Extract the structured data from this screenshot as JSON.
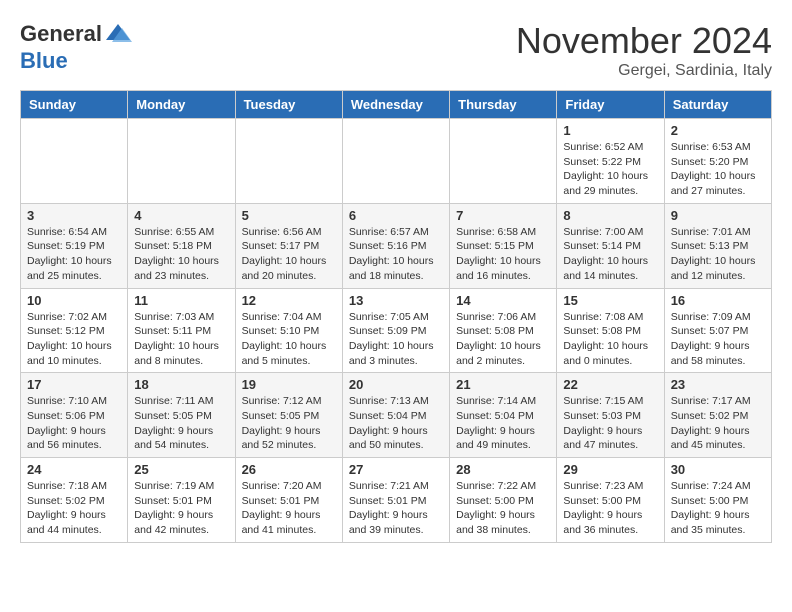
{
  "header": {
    "logo_general": "General",
    "logo_blue": "Blue",
    "month_title": "November 2024",
    "location": "Gergei, Sardinia, Italy"
  },
  "days_of_week": [
    "Sunday",
    "Monday",
    "Tuesday",
    "Wednesday",
    "Thursday",
    "Friday",
    "Saturday"
  ],
  "weeks": [
    [
      {
        "day": "",
        "info": ""
      },
      {
        "day": "",
        "info": ""
      },
      {
        "day": "",
        "info": ""
      },
      {
        "day": "",
        "info": ""
      },
      {
        "day": "",
        "info": ""
      },
      {
        "day": "1",
        "info": "Sunrise: 6:52 AM\nSunset: 5:22 PM\nDaylight: 10 hours and 29 minutes."
      },
      {
        "day": "2",
        "info": "Sunrise: 6:53 AM\nSunset: 5:20 PM\nDaylight: 10 hours and 27 minutes."
      }
    ],
    [
      {
        "day": "3",
        "info": "Sunrise: 6:54 AM\nSunset: 5:19 PM\nDaylight: 10 hours and 25 minutes."
      },
      {
        "day": "4",
        "info": "Sunrise: 6:55 AM\nSunset: 5:18 PM\nDaylight: 10 hours and 23 minutes."
      },
      {
        "day": "5",
        "info": "Sunrise: 6:56 AM\nSunset: 5:17 PM\nDaylight: 10 hours and 20 minutes."
      },
      {
        "day": "6",
        "info": "Sunrise: 6:57 AM\nSunset: 5:16 PM\nDaylight: 10 hours and 18 minutes."
      },
      {
        "day": "7",
        "info": "Sunrise: 6:58 AM\nSunset: 5:15 PM\nDaylight: 10 hours and 16 minutes."
      },
      {
        "day": "8",
        "info": "Sunrise: 7:00 AM\nSunset: 5:14 PM\nDaylight: 10 hours and 14 minutes."
      },
      {
        "day": "9",
        "info": "Sunrise: 7:01 AM\nSunset: 5:13 PM\nDaylight: 10 hours and 12 minutes."
      }
    ],
    [
      {
        "day": "10",
        "info": "Sunrise: 7:02 AM\nSunset: 5:12 PM\nDaylight: 10 hours and 10 minutes."
      },
      {
        "day": "11",
        "info": "Sunrise: 7:03 AM\nSunset: 5:11 PM\nDaylight: 10 hours and 8 minutes."
      },
      {
        "day": "12",
        "info": "Sunrise: 7:04 AM\nSunset: 5:10 PM\nDaylight: 10 hours and 5 minutes."
      },
      {
        "day": "13",
        "info": "Sunrise: 7:05 AM\nSunset: 5:09 PM\nDaylight: 10 hours and 3 minutes."
      },
      {
        "day": "14",
        "info": "Sunrise: 7:06 AM\nSunset: 5:08 PM\nDaylight: 10 hours and 2 minutes."
      },
      {
        "day": "15",
        "info": "Sunrise: 7:08 AM\nSunset: 5:08 PM\nDaylight: 10 hours and 0 minutes."
      },
      {
        "day": "16",
        "info": "Sunrise: 7:09 AM\nSunset: 5:07 PM\nDaylight: 9 hours and 58 minutes."
      }
    ],
    [
      {
        "day": "17",
        "info": "Sunrise: 7:10 AM\nSunset: 5:06 PM\nDaylight: 9 hours and 56 minutes."
      },
      {
        "day": "18",
        "info": "Sunrise: 7:11 AM\nSunset: 5:05 PM\nDaylight: 9 hours and 54 minutes."
      },
      {
        "day": "19",
        "info": "Sunrise: 7:12 AM\nSunset: 5:05 PM\nDaylight: 9 hours and 52 minutes."
      },
      {
        "day": "20",
        "info": "Sunrise: 7:13 AM\nSunset: 5:04 PM\nDaylight: 9 hours and 50 minutes."
      },
      {
        "day": "21",
        "info": "Sunrise: 7:14 AM\nSunset: 5:04 PM\nDaylight: 9 hours and 49 minutes."
      },
      {
        "day": "22",
        "info": "Sunrise: 7:15 AM\nSunset: 5:03 PM\nDaylight: 9 hours and 47 minutes."
      },
      {
        "day": "23",
        "info": "Sunrise: 7:17 AM\nSunset: 5:02 PM\nDaylight: 9 hours and 45 minutes."
      }
    ],
    [
      {
        "day": "24",
        "info": "Sunrise: 7:18 AM\nSunset: 5:02 PM\nDaylight: 9 hours and 44 minutes."
      },
      {
        "day": "25",
        "info": "Sunrise: 7:19 AM\nSunset: 5:01 PM\nDaylight: 9 hours and 42 minutes."
      },
      {
        "day": "26",
        "info": "Sunrise: 7:20 AM\nSunset: 5:01 PM\nDaylight: 9 hours and 41 minutes."
      },
      {
        "day": "27",
        "info": "Sunrise: 7:21 AM\nSunset: 5:01 PM\nDaylight: 9 hours and 39 minutes."
      },
      {
        "day": "28",
        "info": "Sunrise: 7:22 AM\nSunset: 5:00 PM\nDaylight: 9 hours and 38 minutes."
      },
      {
        "day": "29",
        "info": "Sunrise: 7:23 AM\nSunset: 5:00 PM\nDaylight: 9 hours and 36 minutes."
      },
      {
        "day": "30",
        "info": "Sunrise: 7:24 AM\nSunset: 5:00 PM\nDaylight: 9 hours and 35 minutes."
      }
    ]
  ]
}
